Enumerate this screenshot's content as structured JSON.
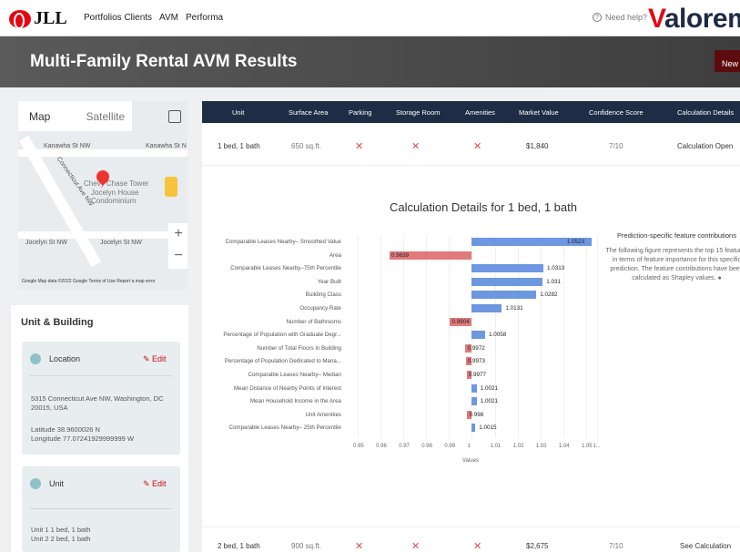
{
  "topbar": {
    "logo": "JLL",
    "nav": [
      "Portfolios Clients",
      "AVM",
      "Performa"
    ],
    "help": "Need help?",
    "brand_v": "V",
    "brand_rest": "alorem"
  },
  "header": {
    "title": "Multi-Family Rental AVM Results",
    "new_button": "New AVM"
  },
  "map": {
    "tabs": [
      "Map",
      "Satellite"
    ],
    "streets": [
      "Kanawha St NW",
      "Kanawha St N",
      "Connecticut Ave NW",
      "Jocelyn St NW",
      "Jocelyn St NW"
    ],
    "pois": [
      "Chevy Chase Tower",
      "Jocelyn House Condominium"
    ],
    "footer": "Google  Map data ©2022 Google   Terms of Use   Report a map error"
  },
  "unit_building": {
    "title": "Unit & Building",
    "location": {
      "title": "Location",
      "edit": "Edit",
      "address": "5315 Connecticut Ave NW, Washington, DC 20015, USA",
      "latitude": "Latitude  38.9600026 N",
      "longitude": "Longitude  77.07241929999999 W"
    },
    "unit": {
      "title": "Unit",
      "edit": "Edit",
      "unit1": "Unit 1   1 bed, 1 bath",
      "unit2": "Unit 2   2 bed, 1 bath"
    }
  },
  "table": {
    "headers": [
      "Unit",
      "Surface Area",
      "Parking",
      "Storage Room",
      "Amenities",
      "Market Value",
      "Confidence Score",
      "Calculation Details"
    ],
    "rows": [
      {
        "unit": "1 bed, 1 bath",
        "area": "650 sq.ft.",
        "parking": "✕",
        "storage": "✕",
        "amenities": "✕",
        "value": "$1,840",
        "score": "7/10",
        "details": "Calculation Open"
      },
      {
        "unit": "2 bed, 1 bath",
        "area": "900 sq.ft.",
        "parking": "✕",
        "storage": "✕",
        "amenities": "✕",
        "value": "$2,675",
        "score": "7/10",
        "details": "See Calculation"
      }
    ]
  },
  "calculation": {
    "title": "Calculation Details for 1 bed, 1 bath",
    "pred_heading": "Prediction-specific feature contributions",
    "pred_text": "The following figure represents the top 15 features in terms of feature importance for this specific prediction. The feature contributions have been calculated as Shapley values.",
    "pred_icon": "info-icon"
  },
  "chart_data": {
    "type": "bar",
    "orientation": "horizontal",
    "categories": [
      "Comparable Leases Nearby– Smoothed Value",
      "Area",
      "Comparable Leases Nearby–75th Percentile",
      "Year Built",
      "Building Class",
      "Occupancy Rate",
      "Number of Bathrooms",
      "Percentage of Population with Graduate Degr...",
      "Number of Total Floors in Building",
      "Percentage of Population Dedicated to Mana...",
      "Comparable Leases Nearby– Median",
      "Mean Distance of Nearby Points of Interest",
      "Mean Household Income in the Area",
      "Unit Amenities",
      "Comparable Leases Nearby– 25th Percentile"
    ],
    "values": [
      1.0523,
      0.9639,
      1.0313,
      1.031,
      1.0282,
      1.0131,
      0.9904,
      1.0058,
      0.9972,
      0.9973,
      0.9977,
      1.0021,
      1.0021,
      0.998,
      1.0015
    ],
    "value_labels": [
      "1.0523",
      "0.9639",
      "1.0313",
      "1.031",
      "1.0282",
      "1.0131",
      "0.9904",
      "1.0058",
      "0.9972",
      "0.9973",
      "0.9977",
      "1.0021",
      "1.0021",
      "0.998",
      "1.0015"
    ],
    "baseline": 1.0,
    "xlim": [
      0.946,
      1.056
    ],
    "xticks": [
      "0.95",
      "0.96",
      "0.97",
      "0.98",
      "0.99",
      "1",
      "1.01",
      "1.02",
      "1.03",
      "1.04",
      "1.05",
      "1..."
    ],
    "xtick_values": [
      0.95,
      0.96,
      0.97,
      0.98,
      0.99,
      1.0,
      1.01,
      1.02,
      1.03,
      1.04,
      1.05,
      1.055
    ],
    "xlabel": "Values",
    "colors": {
      "positive": "#6d97e0",
      "negative": "#e27a7a"
    }
  }
}
